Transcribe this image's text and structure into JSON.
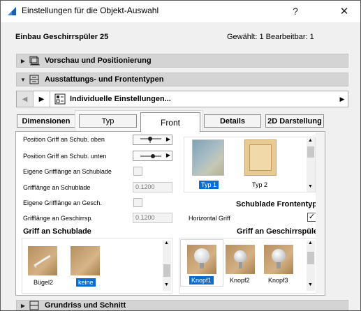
{
  "window": {
    "title": "Einstellungen für die Objekt-Auswahl",
    "help_label": "?",
    "close_label": "✕"
  },
  "header": {
    "object_name": "Einbau Geschirrspüler 25",
    "selection_info": "Gewählt: 1 Bearbeitbar: 1"
  },
  "panels": [
    {
      "label": "Vorschau und Positionierung",
      "arrow": "▶",
      "icon": "preview-positioning-icon"
    },
    {
      "label": "Ausstattungs- und Frontentypen",
      "arrow": "▼",
      "icon": "fittings-fronts-icon"
    },
    {
      "label": "Grundriss und Schnitt",
      "arrow": "▶",
      "icon": "floorplan-section-icon"
    }
  ],
  "page_nav": {
    "back_label": "◀",
    "forward_label": "▶",
    "page_label": "Individuelle Einstellungen...",
    "dropdown_label": "▶"
  },
  "tabs": {
    "dimensionen": "Dimensionen",
    "typ": "Typ",
    "front": "Front",
    "details": "Details",
    "darstellung_2d": "2D Darstellung"
  },
  "params": [
    {
      "label": "Position Griff an Schub. oben",
      "control": "picker"
    },
    {
      "label": "Position Griff an Schub. unten",
      "control": "picker"
    },
    {
      "label": "Eigene Grifflänge an Schublade",
      "control": "checkbox",
      "checked": false
    },
    {
      "label": "Grifflänge an Schublade",
      "control": "number",
      "value": "0.1200"
    },
    {
      "label": "Eigene Grifflänge an Gesch.",
      "control": "checkbox",
      "checked": false
    },
    {
      "label": "Grifflänge an Geschirrsp.",
      "control": "number",
      "value": "0.1200"
    }
  ],
  "front_types": {
    "title": "Schublade Frontentyp",
    "items": [
      {
        "label": "Typ 1",
        "selected": true
      },
      {
        "label": "Typ 2",
        "selected": false
      }
    ]
  },
  "horizontal_griff": {
    "label": "Horizontal Griff",
    "checked": true,
    "check_glyph": "✓"
  },
  "drawer_handles": {
    "title": "Griff an Schublade",
    "items": [
      {
        "label": "Bügel2",
        "selected": false
      },
      {
        "label": "keine",
        "selected": true
      }
    ]
  },
  "dishwasher_handles": {
    "title": "Griff an Geschirrspüler",
    "items": [
      {
        "label": "Knopf1",
        "selected": true
      },
      {
        "label": "Knopf2",
        "selected": false
      },
      {
        "label": "Knopf3",
        "selected": false
      }
    ]
  },
  "scroll_glyphs": {
    "up": "▲",
    "down": "▼"
  },
  "colors": {
    "selection_blue": "#0a6bd1",
    "panel_header": "#d4d4d4",
    "window_bg": "#f0f0f0"
  }
}
